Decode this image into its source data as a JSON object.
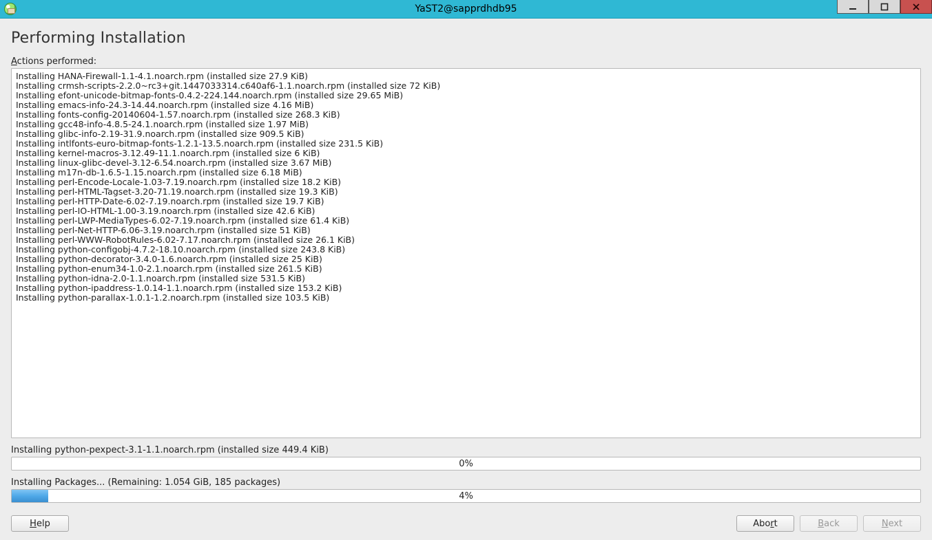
{
  "window": {
    "title": "YaST2@sapprdhdb95"
  },
  "page": {
    "title": "Performing Installation",
    "actions_label_pre": "A",
    "actions_label_rest": "ctions performed:"
  },
  "log_lines": [
    "Installing HANA-Firewall-1.1-4.1.noarch.rpm (installed size 27.9 KiB)",
    "Installing crmsh-scripts-2.2.0~rc3+git.1447033314.c640af6-1.1.noarch.rpm (installed size 72 KiB)",
    "Installing efont-unicode-bitmap-fonts-0.4.2-224.144.noarch.rpm (installed size 29.65 MiB)",
    "Installing emacs-info-24.3-14.44.noarch.rpm (installed size 4.16 MiB)",
    "Installing fonts-config-20140604-1.57.noarch.rpm (installed size 268.3 KiB)",
    "Installing gcc48-info-4.8.5-24.1.noarch.rpm (installed size 1.97 MiB)",
    "Installing glibc-info-2.19-31.9.noarch.rpm (installed size 909.5 KiB)",
    "Installing intlfonts-euro-bitmap-fonts-1.2.1-13.5.noarch.rpm (installed size 231.5 KiB)",
    "Installing kernel-macros-3.12.49-11.1.noarch.rpm (installed size 6 KiB)",
    "Installing linux-glibc-devel-3.12-6.54.noarch.rpm (installed size 3.67 MiB)",
    "Installing m17n-db-1.6.5-1.15.noarch.rpm (installed size 6.18 MiB)",
    "Installing perl-Encode-Locale-1.03-7.19.noarch.rpm (installed size 18.2 KiB)",
    "Installing perl-HTML-Tagset-3.20-71.19.noarch.rpm (installed size 19.3 KiB)",
    "Installing perl-HTTP-Date-6.02-7.19.noarch.rpm (installed size 19.7 KiB)",
    "Installing perl-IO-HTML-1.00-3.19.noarch.rpm (installed size 42.6 KiB)",
    "Installing perl-LWP-MediaTypes-6.02-7.19.noarch.rpm (installed size 61.4 KiB)",
    "Installing perl-Net-HTTP-6.06-3.19.noarch.rpm (installed size 51 KiB)",
    "Installing perl-WWW-RobotRules-6.02-7.17.noarch.rpm (installed size 26.1 KiB)",
    "Installing python-configobj-4.7.2-18.10.noarch.rpm (installed size 243.8 KiB)",
    "Installing python-decorator-3.4.0-1.6.noarch.rpm (installed size 25 KiB)",
    "Installing python-enum34-1.0-2.1.noarch.rpm (installed size 261.5 KiB)",
    "Installing python-idna-2.0-1.1.noarch.rpm (installed size 531.5 KiB)",
    "Installing python-ipaddress-1.0.14-1.1.noarch.rpm (installed size 153.2 KiB)",
    "Installing python-parallax-1.0.1-1.2.noarch.rpm (installed size 103.5 KiB)"
  ],
  "current_package": {
    "label": "Installing python-pexpect-3.1-1.1.noarch.rpm (installed size 449.4 KiB)",
    "percent_text": "0%",
    "percent_value": 0
  },
  "overall": {
    "label": "Installing Packages... (Remaining: 1.054 GiB, 185 packages)",
    "percent_text": "4%",
    "percent_value": 4
  },
  "buttons": {
    "help_pre": "H",
    "help_rest": "elp",
    "abort_pre": "Abo",
    "abort_ul": "r",
    "abort_post": "t",
    "back_pre": "B",
    "back_rest": "ack",
    "next_pre": "N",
    "next_rest": "ext"
  }
}
